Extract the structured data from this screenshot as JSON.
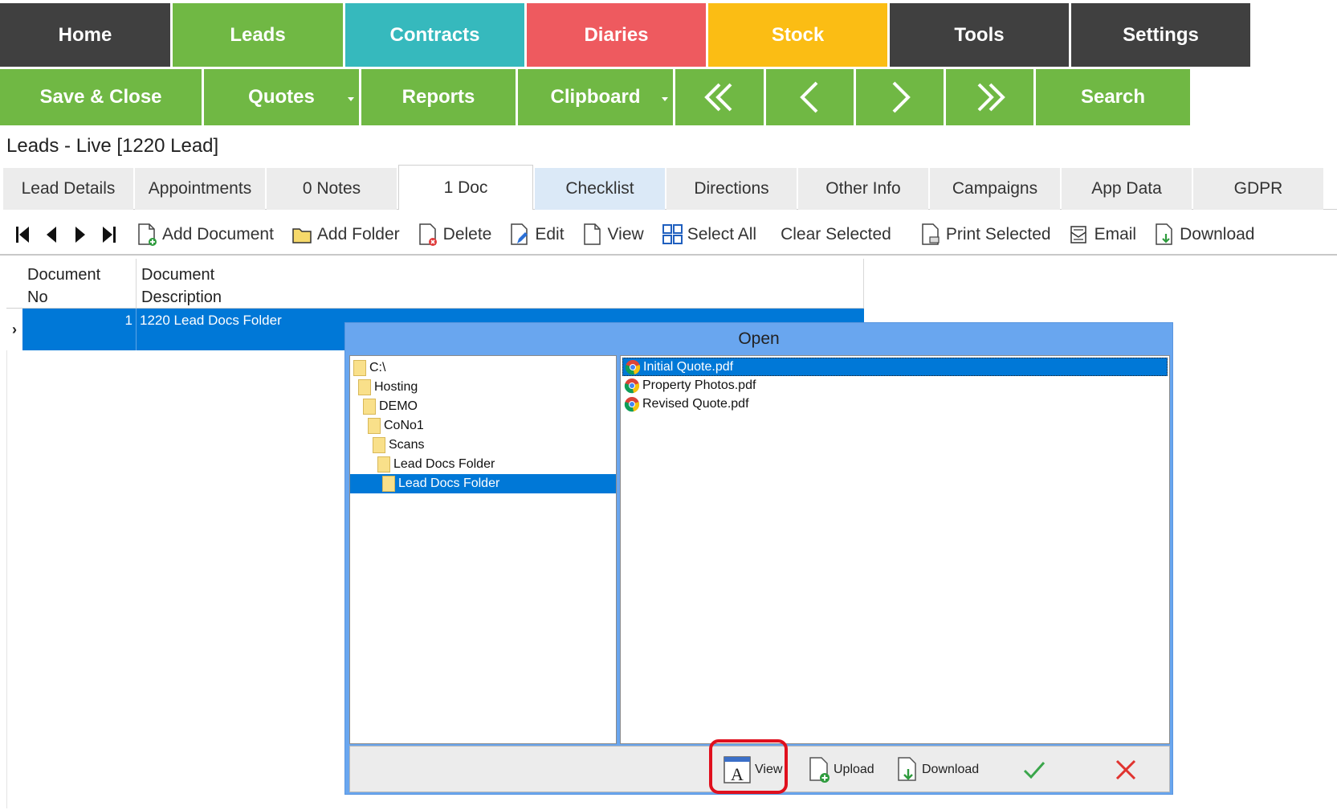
{
  "nav": {
    "home": "Home",
    "leads": "Leads",
    "contracts": "Contracts",
    "diaries": "Diaries",
    "stock": "Stock",
    "tools": "Tools",
    "settings": "Settings"
  },
  "actions": {
    "save_close": "Save & Close",
    "quotes": "Quotes",
    "reports": "Reports",
    "clipboard": "Clipboard",
    "search": "Search"
  },
  "colors": {
    "dark": "#404040",
    "green": "#70b844",
    "teal": "#36b9bd",
    "red": "#ee5a5f",
    "yellow": "#fbbd14",
    "selection": "#0078d7"
  },
  "page_title": "Leads - Live [1220  Lead]",
  "tabs": [
    "Lead Details",
    "Appointments",
    "0 Notes",
    "1 Doc",
    "Checklist",
    "Directions",
    "Other Info",
    "Campaigns",
    "App Data",
    "GDPR"
  ],
  "toolbar": {
    "add_document": "Add Document",
    "add_folder": "Add Folder",
    "delete": "Delete",
    "edit": "Edit",
    "view": "View",
    "select_all": "Select All",
    "clear_selected": "Clear Selected",
    "print_selected": "Print Selected",
    "email": "Email",
    "download": "Download"
  },
  "grid": {
    "col_no_line1": "Document",
    "col_no_line2": "No",
    "col_desc_line1": "Document",
    "col_desc_line2": "Description",
    "rows": [
      {
        "no": "1",
        "description": "1220 Lead Docs Folder"
      }
    ]
  },
  "dialog": {
    "title": "Open",
    "folders": [
      "C:\\",
      "Hosting",
      "DEMO",
      "CoNo1",
      "Scans",
      "Lead Docs Folder",
      "Lead Docs Folder"
    ],
    "files": [
      "Initial Quote.pdf",
      "Property Photos.pdf",
      "Revised Quote.pdf"
    ],
    "view": "View",
    "upload": "Upload",
    "download": "Download"
  }
}
